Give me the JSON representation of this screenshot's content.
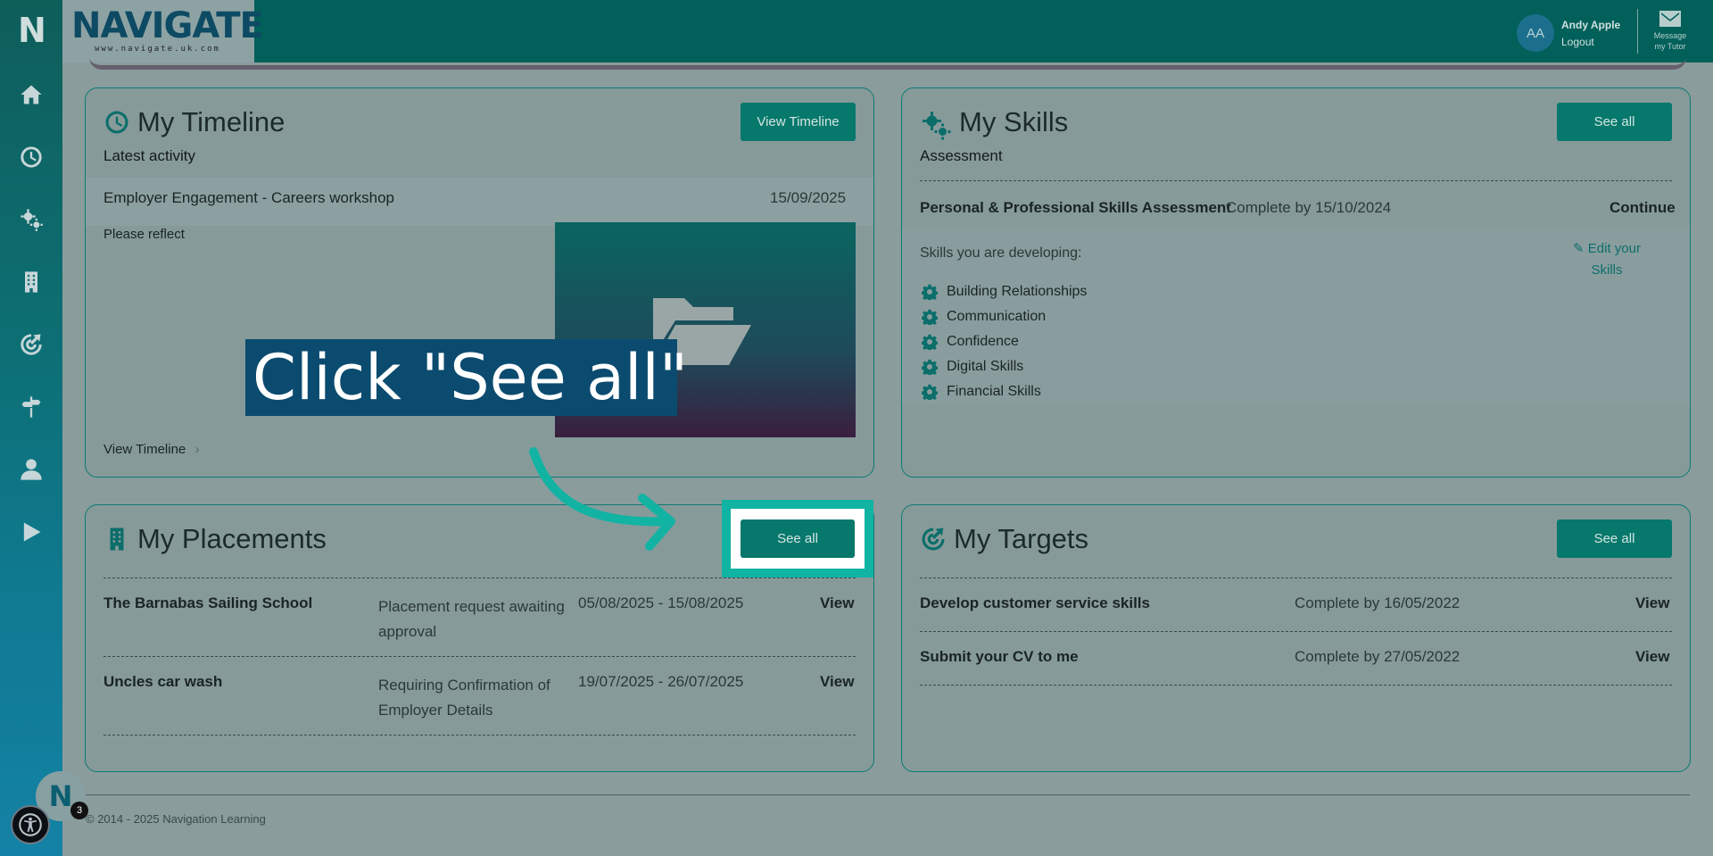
{
  "header": {
    "brand_word": "NAVIGATE",
    "brand_url": "www.navigate.uk.com",
    "sidebar_logo": "N",
    "user_initials": "AA",
    "user_name": "Andy Apple",
    "logout_label": "Logout",
    "message_label": "Message my Tutor"
  },
  "sidebar": {
    "items": [
      {
        "icon": "home-icon"
      },
      {
        "icon": "clock-icon"
      },
      {
        "icon": "gears-icon"
      },
      {
        "icon": "building-icon"
      },
      {
        "icon": "target-icon"
      },
      {
        "icon": "signpost-icon"
      },
      {
        "icon": "user-icon"
      },
      {
        "icon": "play-icon"
      }
    ]
  },
  "timeline": {
    "title": "My Timeline",
    "button": "View Timeline",
    "subhead": "Latest activity",
    "entry_title": "Employer Engagement - Careers workshop",
    "entry_date": "15/09/2025",
    "entry_note": "Please reflect",
    "footer_link": "View Timeline",
    "footer_chevron": "›"
  },
  "skills": {
    "title": "My Skills",
    "button": "See all",
    "subhead": "Assessment",
    "assessment_name": "Personal & Professional Skills Assessment",
    "assessment_due": "Complete by 15/10/2024",
    "assessment_action": "Continue",
    "developing_label": "Skills you are developing:",
    "edit_link": "Edit your Skills",
    "items": [
      "Building Relationships",
      "Communication",
      "Confidence",
      "Digital Skills",
      "Financial Skills"
    ]
  },
  "placements": {
    "title": "My Placements",
    "button": "See all",
    "rows": [
      {
        "name": "The Barnabas Sailing School",
        "status": "Placement request awaiting approval",
        "dates": "05/08/2025 - 15/08/2025",
        "action": "View"
      },
      {
        "name": "Uncles car wash",
        "status": "Requiring Confirmation of Employer Details",
        "dates": "19/07/2025 - 26/07/2025",
        "action": "View"
      }
    ]
  },
  "targets": {
    "title": "My Targets",
    "button": "See all",
    "rows": [
      {
        "name": "Develop customer service skills",
        "due": "Complete by 16/05/2022",
        "action": "View"
      },
      {
        "name": "Submit your CV to me",
        "due": "Complete by 27/05/2022",
        "action": "View"
      }
    ]
  },
  "overlay": {
    "callout": "Click \"See all\""
  },
  "footer": {
    "copyright": "© 2014 - 2025 Navigation Learning",
    "chat_logo": "N",
    "chat_badge": "3"
  },
  "colors": {
    "accent": "#07786c",
    "header": "#02605a",
    "highlight": "#11b3a3",
    "callout_bg": "#0b4b6f"
  }
}
